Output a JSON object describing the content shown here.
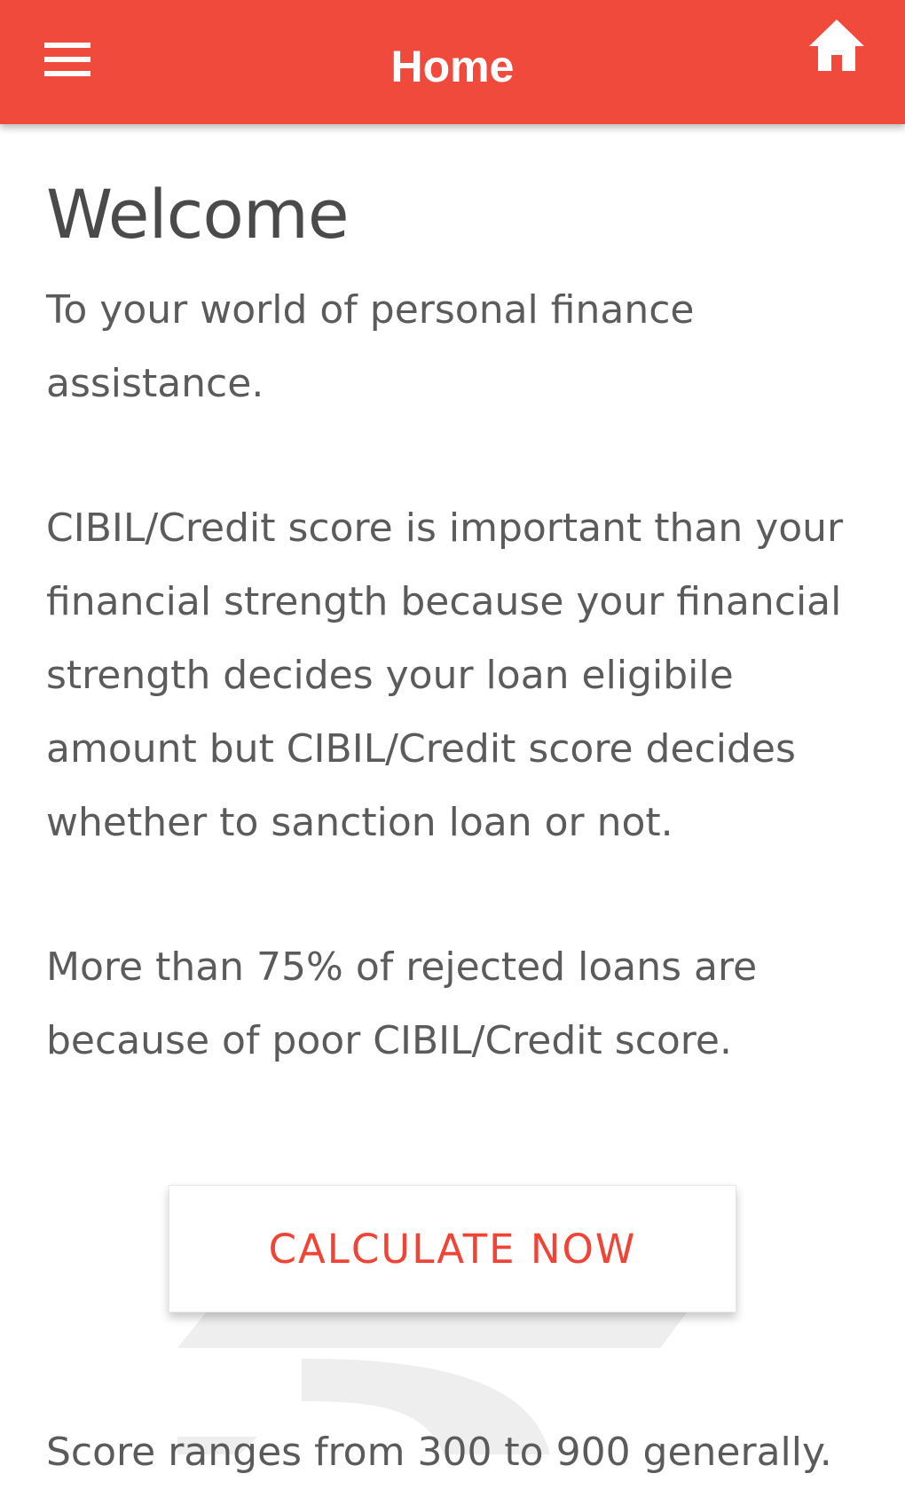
{
  "app_bar": {
    "title": "Home",
    "menu_icon": "hamburger-menu-icon",
    "home_icon": "home-icon",
    "color": "#f04a3c"
  },
  "content": {
    "heading": "Welcome",
    "paragraphs": [
      "To your world of personal finance assistance.",
      "CIBIL/Credit score is important than your financial strength because your financial strength decides your loan eligibile amount but CIBIL/Credit score decides whether to sanction loan or not.",
      "More than 75% of rejected loans are because of poor CIBIL/Credit score."
    ]
  },
  "cta": {
    "label": "CALCULATE NOW",
    "color": "#ef4436"
  },
  "watermark_icon": "rupee-icon",
  "cutoff_text": "Score ranges from 300 to 900 generally."
}
